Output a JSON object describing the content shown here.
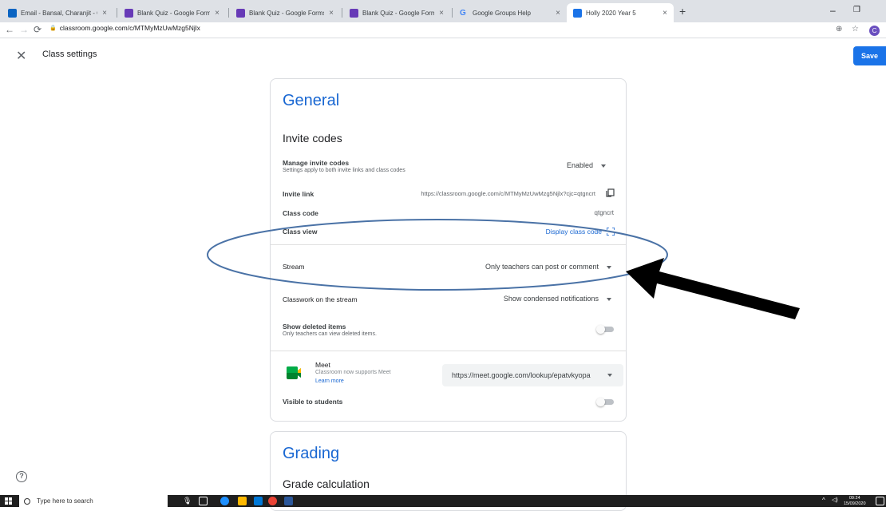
{
  "browser": {
    "tabs": [
      {
        "title": "Email - Bansal, Charanjit - Outlo",
        "favicon_color": "#0a64c2"
      },
      {
        "title": "Blank Quiz - Google Forms",
        "favicon_color": "#673ab7"
      },
      {
        "title": "Blank Quiz - Google Forms",
        "favicon_color": "#673ab7"
      },
      {
        "title": "Blank Quiz - Google Forms",
        "favicon_color": "#673ab7"
      },
      {
        "title": "Google Groups Help",
        "favicon_color": "#4285f4"
      },
      {
        "title": "Holly 2020 Year 5",
        "favicon_color": "#1a73e8"
      }
    ],
    "url": "classroom.google.com/c/MTMyMzUwMzg5Njlx",
    "profile_initial": "C"
  },
  "app": {
    "title": "Class settings",
    "save_label": "Save"
  },
  "general": {
    "title": "General",
    "invite_codes_title": "Invite codes",
    "manage_label": "Manage invite codes",
    "manage_sub": "Settings apply to both invite links and class codes",
    "manage_value": "Enabled",
    "invite_link_label": "Invite link",
    "invite_link_value": "https://classroom.google.com/c/MTMyMzUwMzg5Njlx?cjc=qtgncrt",
    "class_code_label": "Class code",
    "class_code_value": "qtgncrt",
    "class_view_label": "Class view",
    "class_view_value": "Display class code",
    "stream_label": "Stream",
    "stream_value": "Only teachers can post or comment",
    "classwork_label": "Classwork on the stream",
    "classwork_value": "Show condensed notifications",
    "deleted_label": "Show deleted items",
    "deleted_sub": "Only teachers can view deleted items.",
    "meet_label": "Meet",
    "meet_sub": "Classroom now supports Meet",
    "meet_learn": "Learn more",
    "meet_link": "https://meet.google.com/lookup/epatvkyopa",
    "visible_label": "Visible to students"
  },
  "grading": {
    "title": "Grading",
    "calc_title": "Grade calculation"
  },
  "taskbar": {
    "search_placeholder": "Type here to search",
    "time": "09:24",
    "date": "15/09/2020"
  },
  "annotation": {
    "ellipse_color": "#4a72a6",
    "arrow_color": "#000000"
  }
}
